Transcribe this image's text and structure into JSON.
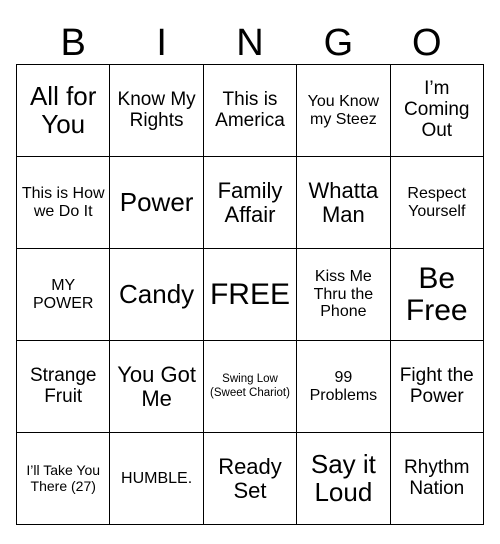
{
  "header": {
    "letters": [
      "B",
      "I",
      "N",
      "G",
      "O"
    ]
  },
  "grid": {
    "rows": [
      [
        {
          "text": "All for You",
          "size": "fs-xxl"
        },
        {
          "text": "Know My Rights",
          "size": "fs-l"
        },
        {
          "text": "This is America",
          "size": "fs-l"
        },
        {
          "text": "You Know my Steez",
          "size": "fs-m"
        },
        {
          "text": "I’m Coming Out",
          "size": "fs-l"
        }
      ],
      [
        {
          "text": "This is How we Do It",
          "size": "fs-m"
        },
        {
          "text": "Power",
          "size": "fs-xxl"
        },
        {
          "text": "Family Affair",
          "size": "fs-xl"
        },
        {
          "text": "Whatta Man",
          "size": "fs-xl"
        },
        {
          "text": "Respect Yourself",
          "size": "fs-m"
        }
      ],
      [
        {
          "text": "MY POWER",
          "size": "fs-m"
        },
        {
          "text": "Candy",
          "size": "fs-xxl"
        },
        {
          "text": "FREE",
          "size": "fs-3xl"
        },
        {
          "text": "Kiss Me Thru the Phone",
          "size": "fs-m"
        },
        {
          "text": "Be Free",
          "size": "fs-3xl"
        }
      ],
      [
        {
          "text": "Strange Fruit",
          "size": "fs-l"
        },
        {
          "text": "You Got Me",
          "size": "fs-xl"
        },
        {
          "text": "Swing Low (Sweet Chariot)",
          "size": "fs-xs"
        },
        {
          "text": "99 Problems",
          "size": "fs-m"
        },
        {
          "text": "Fight the Power",
          "size": "fs-l"
        }
      ],
      [
        {
          "text": "I’ll Take You There (27)",
          "size": "fs-s"
        },
        {
          "text": "HUMBLE.",
          "size": "fs-m"
        },
        {
          "text": "Ready Set",
          "size": "fs-xl"
        },
        {
          "text": "Say it Loud",
          "size": "fs-xxl"
        },
        {
          "text": "Rhythm Nation",
          "size": "fs-l"
        }
      ]
    ]
  }
}
